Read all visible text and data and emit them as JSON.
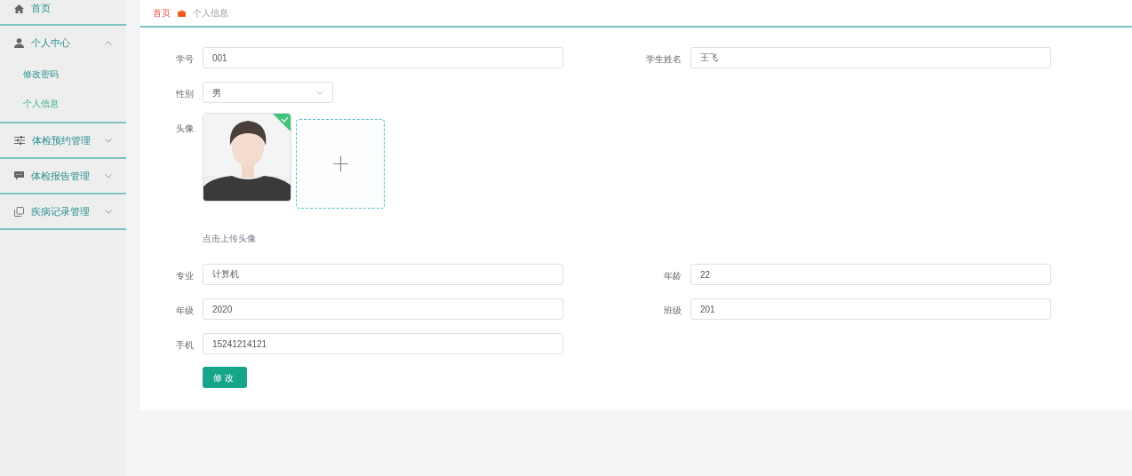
{
  "sidebar": {
    "items": [
      {
        "label": "首页",
        "selected": false
      },
      {
        "label": "个人中心",
        "expanded": true,
        "selected": false,
        "children": [
          {
            "label": "修改密码",
            "selected": false
          },
          {
            "label": "个人信息",
            "selected": true
          }
        ]
      },
      {
        "label": "体检预约管理",
        "expanded": false,
        "selected": false
      },
      {
        "label": "体检报告管理",
        "expanded": false,
        "selected": false
      },
      {
        "label": "疾病记录管理",
        "expanded": false,
        "selected": false
      }
    ]
  },
  "breadcrumb": [
    {
      "label": "首页",
      "kind": "link"
    },
    {
      "label": "个人信息",
      "kind": "current"
    }
  ],
  "form": {
    "rows": [
      [
        {
          "kind": "text",
          "label": "学号",
          "value": "001"
        },
        {
          "kind": "text",
          "label": "学生姓名",
          "value": "王飞"
        }
      ],
      [
        {
          "kind": "select",
          "label": "性别",
          "value": "男"
        }
      ],
      [
        {
          "kind": "avatar",
          "label": "头像",
          "uploaded": true,
          "hint": "点击上传头像"
        }
      ],
      [
        {
          "kind": "text",
          "label": "专业",
          "value": "计算机"
        },
        {
          "kind": "text",
          "label": "年龄",
          "value": "22"
        }
      ],
      [
        {
          "kind": "text",
          "label": "年级",
          "value": "2020"
        },
        {
          "kind": "text",
          "label": "班级",
          "value": "201"
        }
      ],
      [
        {
          "kind": "text",
          "label": "手机",
          "value": "15241214121"
        }
      ]
    ],
    "submit": "修改"
  }
}
